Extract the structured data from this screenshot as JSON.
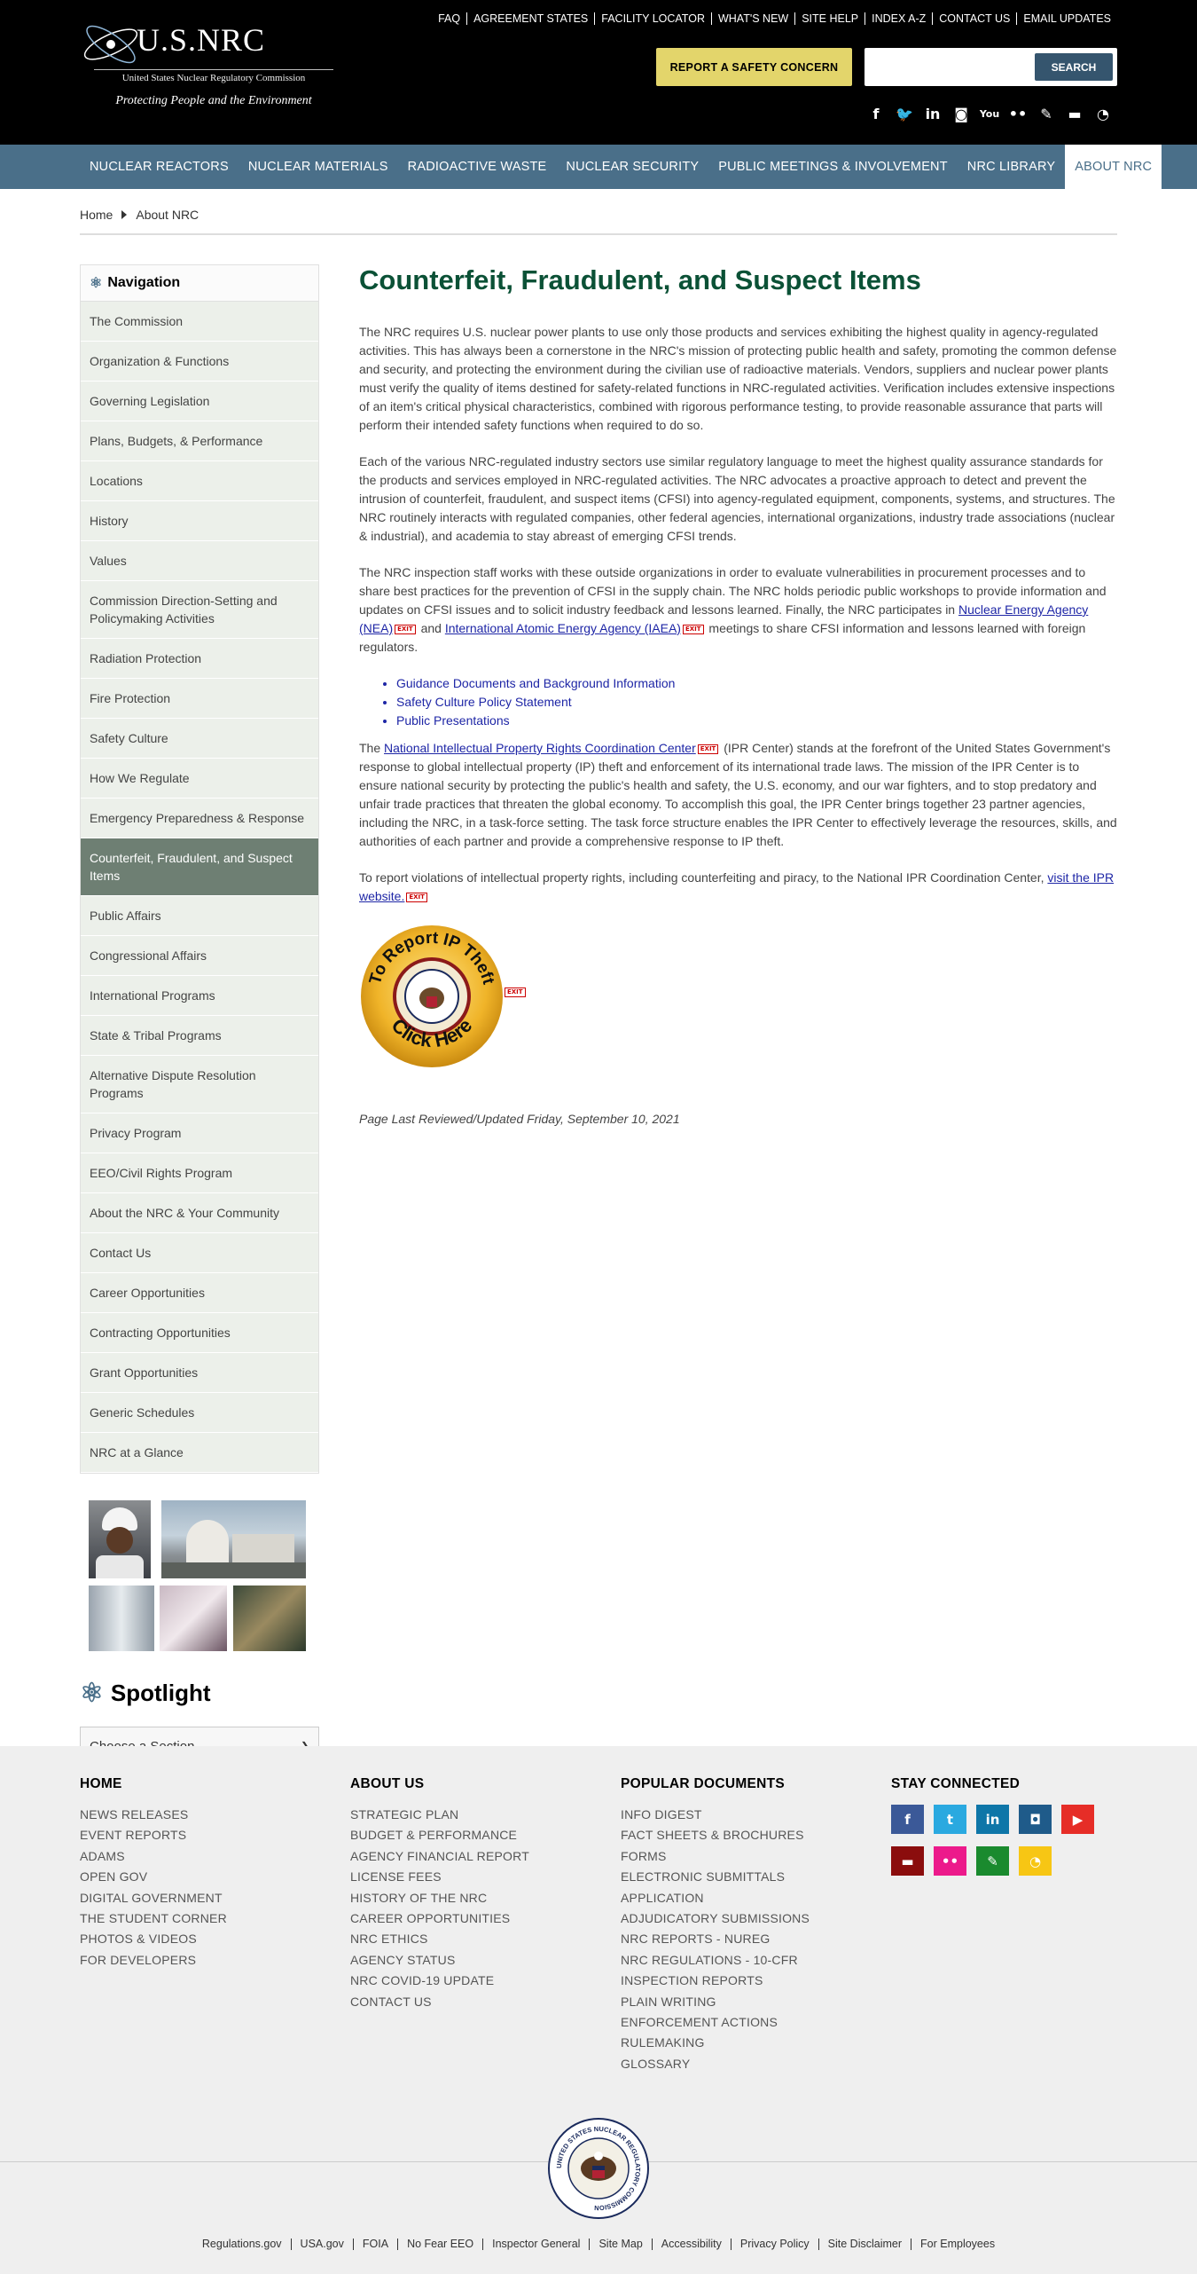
{
  "header": {
    "logo_abbr": "U.S.NRC",
    "logo_sub": "United States Nuclear Regulatory Commission",
    "logo_tagline": "Protecting People and the Environment",
    "utility_links": [
      "FAQ",
      "AGREEMENT STATES",
      "FACILITY LOCATOR",
      "WHAT'S NEW",
      "SITE HELP",
      "INDEX A-Z",
      "CONTACT US",
      "EMAIL UPDATES"
    ],
    "report_button": "REPORT A SAFETY CONCERN",
    "search_value": "",
    "search_button": "SEARCH",
    "social_icons": [
      "facebook-icon",
      "twitter-icon",
      "linkedin-icon",
      "instagram-icon",
      "youtube-icon",
      "flickr-icon",
      "blog-icon",
      "comment-icon",
      "rss-icon"
    ]
  },
  "mainnav": [
    "NUCLEAR REACTORS",
    "NUCLEAR MATERIALS",
    "RADIOACTIVE WASTE",
    "NUCLEAR SECURITY",
    "PUBLIC MEETINGS & INVOLVEMENT",
    "NRC LIBRARY",
    "ABOUT NRC"
  ],
  "breadcrumb": {
    "home": "Home",
    "current": "About NRC"
  },
  "sidebar": {
    "heading": "Navigation",
    "items": [
      "The Commission",
      "Organization & Functions",
      "Governing Legislation",
      "Plans, Budgets, & Performance",
      "Locations",
      "History",
      "Values",
      "Commission Direction-Setting and Policymaking Activities",
      "Radiation Protection",
      "Fire Protection",
      "Safety Culture",
      "How We Regulate",
      "Emergency Preparedness & Response",
      "Counterfeit, Fraudulent, and Suspect Items",
      "Public Affairs",
      "Congressional Affairs",
      "International Programs",
      "State & Tribal Programs",
      "Alternative Dispute Resolution Programs",
      "Privacy Program",
      "EEO/Civil Rights Program",
      "About the NRC & Your Community",
      "Contact Us",
      "Career Opportunities",
      "Contracting Opportunities",
      "Grant Opportunities",
      "Generic Schedules",
      "NRC at a Glance"
    ],
    "active_index": 13,
    "spotlight": "Spotlight",
    "select_value": "Choose a Section"
  },
  "main": {
    "title": "Counterfeit, Fraudulent, and Suspect Items",
    "p1": "The NRC requires U.S. nuclear power plants to use only those products and services exhibiting the highest quality in agency-regulated activities. This has always been a cornerstone in the NRC's mission of protecting public health and safety, promoting the common defense and security, and protecting the environment during the civilian use of radioactive materials. Vendors, suppliers and nuclear power plants must verify the quality of items destined for safety-related functions in NRC-regulated activities. Verification includes extensive inspections of an item's critical physical characteristics, combined with rigorous performance testing, to provide reasonable assurance that parts will perform their intended safety functions when required to do so.",
    "p2": "Each of the various NRC-regulated industry sectors use similar regulatory language to meet the highest quality assurance standards for the products and services employed in NRC-regulated activities. The NRC advocates a proactive approach to detect and prevent the intrusion of counterfeit, fraudulent, and suspect items (CFSI) into agency-regulated equipment, components, systems, and structures. The NRC routinely interacts with regulated companies, other federal agencies, international organizations, industry trade associations (nuclear & industrial), and academia to stay abreast of emerging CFSI trends.",
    "p3_a": "The NRC inspection staff works with these outside organizations in order to evaluate vulnerabilities in procurement processes and to share best practices for the prevention of CFSI in the supply chain. The NRC holds periodic public workshops to provide information and updates on CFSI issues and to solicit industry feedback and lessons learned. Finally, the NRC participates in ",
    "p3_link1": "Nuclear Energy Agency (NEA)",
    "p3_b": " and ",
    "p3_link2": "International Atomic Energy Agency (IAEA)",
    "p3_c": " meetings to share CFSI information and lessons learned with foreign regulators.",
    "bullets": [
      "Guidance Documents and Background Information",
      "Safety Culture Policy Statement",
      "Public Presentations"
    ],
    "p4_a": "The ",
    "p4_link": "National Intellectual Property Rights Coordination Center",
    "p4_b": " (IPR Center) stands at the forefront of the United States Government's response to global intellectual property (IP) theft and enforcement of its international trade laws. The mission of the IPR Center is to ensure national security by protecting the public's health and safety, the U.S. economy, and our war fighters, and to stop predatory and unfair trade practices that threaten the global economy. To accomplish this goal, the IPR Center brings together 23 partner agencies, including the NRC, in a task-force setting. The task force structure enables the IPR Center to effectively leverage the resources, skills, and authorities of each partner and provide a comprehensive response to IP theft.",
    "p5_a": "To report violations of intellectual property rights, including counterfeiting and piracy, to the National IPR Coordination Center, ",
    "p5_link": "visit the IPR website.",
    "exit_label": "EXIT",
    "ip_top": "To Report IP Theft",
    "ip_bottom": "Click Here",
    "reviewed": "Page Last Reviewed/Updated Friday, September 10, 2021"
  },
  "footer": {
    "col1": {
      "heading": "HOME",
      "links": [
        "NEWS RELEASES",
        "EVENT REPORTS",
        "ADAMS",
        "OPEN GOV",
        "DIGITAL GOVERNMENT",
        "THE STUDENT CORNER",
        "PHOTOS & VIDEOS",
        "FOR DEVELOPERS"
      ]
    },
    "col2": {
      "heading": "ABOUT US",
      "links": [
        "STRATEGIC PLAN",
        "BUDGET & PERFORMANCE",
        "AGENCY FINANCIAL REPORT",
        "LICENSE FEES",
        "HISTORY OF THE NRC",
        "CAREER OPPORTUNITIES",
        "NRC ETHICS",
        "AGENCY STATUS",
        "NRC COVID-19 UPDATE",
        "CONTACT US"
      ]
    },
    "col3": {
      "heading": "POPULAR DOCUMENTS",
      "links": [
        "INFO DIGEST",
        "FACT SHEETS & BROCHURES",
        "FORMS",
        "ELECTRONIC SUBMITTALS",
        "APPLICATION",
        "ADJUDICATORY SUBMISSIONS",
        "NRC REPORTS - NUREG",
        "NRC REGULATIONS - 10-CFR",
        "INSPECTION REPORTS",
        "PLAIN WRITING",
        "ENFORCEMENT ACTIONS",
        "RULEMAKING",
        "GLOSSARY"
      ]
    },
    "col4": {
      "heading": "STAY CONNECTED"
    },
    "stay_icons": [
      {
        "name": "facebook-icon",
        "color": "#3b5998",
        "glyph": "f"
      },
      {
        "name": "twitter-icon",
        "color": "#2aa9e0",
        "glyph": "t"
      },
      {
        "name": "linkedin-icon",
        "color": "#0e76a8",
        "glyph": "in"
      },
      {
        "name": "instagram-icon",
        "color": "#1f5b8a",
        "glyph": "◘"
      },
      {
        "name": "youtube-icon",
        "color": "#e62d27",
        "glyph": "▶"
      },
      {
        "name": "comment-icon",
        "color": "#8b0d0d",
        "glyph": "▬"
      },
      {
        "name": "flickr-icon",
        "color": "#ec1a8b",
        "glyph": "••"
      },
      {
        "name": "blog-icon",
        "color": "#1a8a2e",
        "glyph": "✎"
      },
      {
        "name": "rss-icon",
        "color": "#f7c614",
        "glyph": "◔"
      }
    ],
    "seal_text": "UNITED STATES NUCLEAR REGULATORY COMMISSION",
    "bottom_links": [
      "Regulations.gov",
      "USA.gov",
      "FOIA",
      "No Fear EEO",
      "Inspector General",
      "Site Map",
      "Accessibility",
      "Privacy Policy",
      "Site Disclaimer",
      "For Employees"
    ]
  }
}
